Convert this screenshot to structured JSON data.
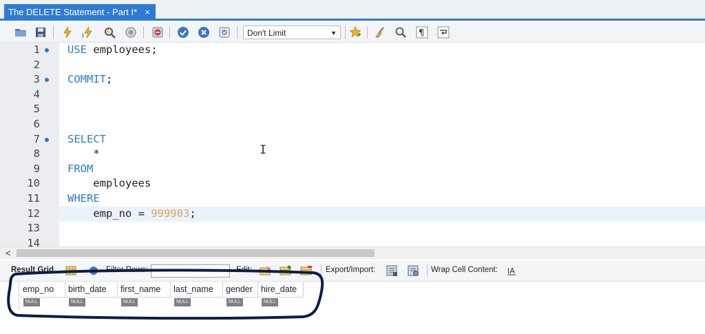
{
  "tab": {
    "title": "The DELETE Statement - Part I*",
    "close": "×"
  },
  "toolbar": {
    "limit_label": "Don't Limit"
  },
  "editor": {
    "lines": [
      {
        "n": "1",
        "dot": true,
        "text": "USE employees;"
      },
      {
        "n": "2",
        "dot": false,
        "text": ""
      },
      {
        "n": "3",
        "dot": true,
        "text": "COMMIT;"
      },
      {
        "n": "4",
        "dot": false,
        "text": ""
      },
      {
        "n": "5",
        "dot": false,
        "text": ""
      },
      {
        "n": "6",
        "dot": false,
        "text": ""
      },
      {
        "n": "7",
        "dot": true,
        "text": "SELECT"
      },
      {
        "n": "8",
        "dot": false,
        "text": "    *"
      },
      {
        "n": "9",
        "dot": false,
        "text": "FROM"
      },
      {
        "n": "10",
        "dot": false,
        "text": "    employees"
      },
      {
        "n": "11",
        "dot": false,
        "text": "WHERE"
      },
      {
        "n": "12",
        "dot": false,
        "text": "    emp_no = 999903;"
      },
      {
        "n": "13",
        "dot": false,
        "text": ""
      },
      {
        "n": "14",
        "dot": false,
        "text": ""
      }
    ],
    "cursor_glyph": "I"
  },
  "hscroll": {
    "left_arrow": "<"
  },
  "result_toolbar": {
    "result_grid": "Result Grid",
    "filter_rows": "Filter Rows:",
    "edit": "Edit:",
    "export_import": "Export/Import:",
    "wrap_cell": "Wrap Cell Content:"
  },
  "grid": {
    "columns": [
      "emp_no",
      "birth_date",
      "first_name",
      "last_name",
      "gender",
      "hire_date"
    ],
    "null_label": "NULL"
  },
  "colors": {
    "accent": "#2f7bd3",
    "keyword": "#2b7cc4",
    "number": "#e0a24f",
    "annotation": "#0c1d4a"
  }
}
